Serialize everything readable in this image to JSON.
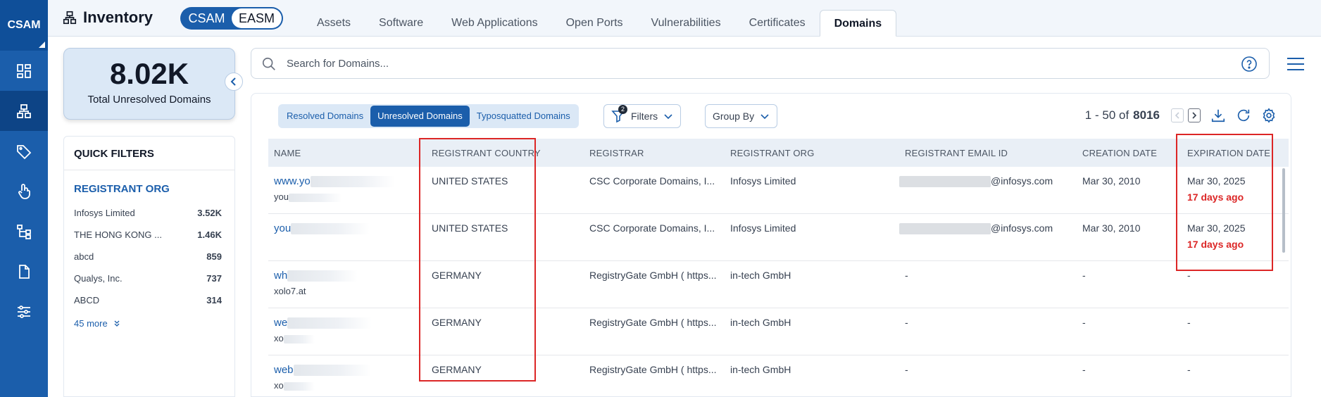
{
  "rail": {
    "brand": "CSAM",
    "items": [
      "dashboard-icon",
      "inventory-icon",
      "tag-icon",
      "touch-icon",
      "hierarchy-icon",
      "document-icon",
      "sliders-icon"
    ]
  },
  "header": {
    "title": "Inventory",
    "toggle": {
      "left": "CSAM",
      "right": "EASM"
    },
    "tabs": [
      "Assets",
      "Software",
      "Web Applications",
      "Open Ports",
      "Vulnerabilities",
      "Certificates",
      "Domains"
    ],
    "active_tab": "Domains"
  },
  "stat": {
    "value": "8.02K",
    "label": "Total Unresolved Domains"
  },
  "quick_filters": {
    "title": "QUICK FILTERS",
    "section": "REGISTRANT ORG",
    "items": [
      {
        "label": "Infosys Limited",
        "count": "3.52K"
      },
      {
        "label": "THE HONG KONG ...",
        "count": "1.46K"
      },
      {
        "label": "abcd",
        "count": "859"
      },
      {
        "label": "Qualys, Inc.",
        "count": "737"
      },
      {
        "label": "ABCD",
        "count": "314"
      }
    ],
    "more": "45 more"
  },
  "search": {
    "placeholder": "Search for Domains..."
  },
  "segments": [
    "Resolved Domains",
    "Unresolved Domains",
    "Typosquatted Domains"
  ],
  "active_segment": "Unresolved Domains",
  "filters": {
    "label": "Filters",
    "badge": "2"
  },
  "group_by": {
    "label": "Group By"
  },
  "pager": {
    "range": "1 - 50 of",
    "total": "8016"
  },
  "table": {
    "columns": [
      "NAME",
      "REGISTRANT COUNTRY",
      "REGISTRAR",
      "REGISTRANT ORG",
      "REGISTRANT EMAIL ID",
      "CREATION DATE",
      "EXPIRATION DATE"
    ],
    "rows": [
      {
        "name": "www.yo",
        "subname": "you",
        "country": "UNITED STATES",
        "registrar": "CSC Corporate Domains, I...",
        "org": "Infosys Limited",
        "email": "@infosys.com",
        "created": "Mar 30, 2010",
        "expires": "Mar 30, 2025",
        "expires_note": "17 days ago"
      },
      {
        "name": "you",
        "subname": "",
        "country": "UNITED STATES",
        "registrar": "CSC Corporate Domains, I...",
        "org": "Infosys Limited",
        "email": "@infosys.com",
        "created": "Mar 30, 2010",
        "expires": "Mar 30, 2025",
        "expires_note": "17 days ago"
      },
      {
        "name": "wh",
        "subname": "xolo7.at",
        "country": "GERMANY",
        "registrar": "RegistryGate GmbH ( https...",
        "org": "in-tech GmbH",
        "email": "-",
        "created": "-",
        "expires": "-",
        "expires_note": ""
      },
      {
        "name": "we",
        "subname": "xo",
        "country": "GERMANY",
        "registrar": "RegistryGate GmbH ( https...",
        "org": "in-tech GmbH",
        "email": "-",
        "created": "-",
        "expires": "-",
        "expires_note": ""
      },
      {
        "name": "web",
        "subname": "xo",
        "country": "GERMANY",
        "registrar": "RegistryGate GmbH ( https...",
        "org": "in-tech GmbH",
        "email": "-",
        "created": "-",
        "expires": "-",
        "expires_note": ""
      }
    ]
  },
  "colors": {
    "brand": "#1b5eab",
    "highlight": "#dc2626",
    "overdue": "#dc2626"
  }
}
